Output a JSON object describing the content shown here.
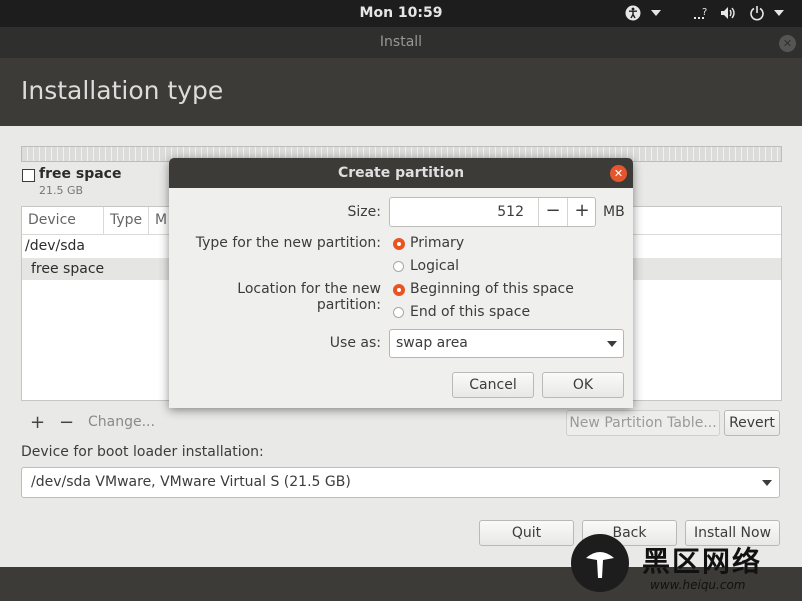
{
  "topbar": {
    "clock": "Mon 10:59",
    "icons": [
      "accessibility-icon",
      "chevron-down-icon",
      "network-icon",
      "volume-icon",
      "power-icon",
      "chevron-down-icon"
    ]
  },
  "window": {
    "title": "Install",
    "close_icon": "close-icon"
  },
  "page": {
    "title": "Installation type"
  },
  "disk_legend": {
    "label": "free space",
    "size": "21.5 GB"
  },
  "partition_table": {
    "headers": [
      "Device",
      "Type",
      "M"
    ],
    "rows": [
      {
        "device": "/dev/sda",
        "selected": false
      },
      {
        "device": "free space",
        "selected": true
      }
    ]
  },
  "table_tools": {
    "add": "+",
    "remove": "−",
    "change": "Change...",
    "new_table": "New Partition Table...",
    "revert": "Revert"
  },
  "boot": {
    "label": "Device for boot loader installation:",
    "value": "/dev/sda VMware, VMware Virtual S (21.5 GB)"
  },
  "footer": {
    "quit": "Quit",
    "back": "Back",
    "install": "Install Now"
  },
  "dialog": {
    "title": "Create partition",
    "size_label": "Size:",
    "size_value": "512",
    "size_unit": "MB",
    "minus": "−",
    "plus": "+",
    "type_label": "Type for the new partition:",
    "type_primary": "Primary",
    "type_logical": "Logical",
    "type_selected": "Primary",
    "location_label": "Location for the new partition:",
    "location_begin": "Beginning of this space",
    "location_end": "End of this space",
    "location_selected": "Beginning of this space",
    "use_label": "Use as:",
    "use_value": "swap area",
    "cancel": "Cancel",
    "ok": "OK"
  },
  "watermark": {
    "text": "黑区网络",
    "url": "www.heiqu.com"
  },
  "colors": {
    "accent": "#e95420",
    "header_bg": "#3c3b37",
    "topbar_bg": "#1d1d1d"
  }
}
